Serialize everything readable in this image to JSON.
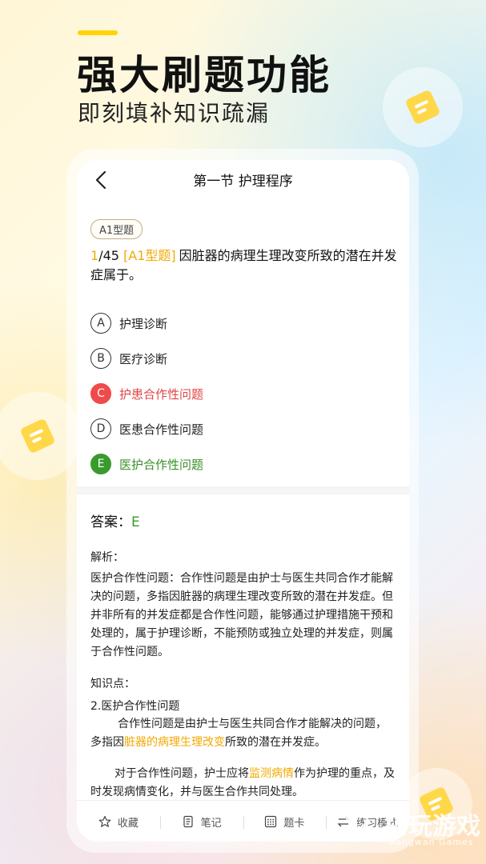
{
  "promo": {
    "headline": "强大刷题功能",
    "subheadline": "即刻填补知识疏漏"
  },
  "nav": {
    "title": "第一节 护理程序"
  },
  "question": {
    "type_tag": "A1型题",
    "number_current": "1",
    "number_total": "/45",
    "type_inline": "[A1型题]",
    "text": "因脏器的病理生理改变所致的潜在并发症属于。"
  },
  "options": [
    {
      "letter": "A",
      "text": "护理诊断",
      "state": "normal"
    },
    {
      "letter": "B",
      "text": "医疗诊断",
      "state": "normal"
    },
    {
      "letter": "C",
      "text": "护患合作性问题",
      "state": "wrong"
    },
    {
      "letter": "D",
      "text": "医患合作性问题",
      "state": "normal"
    },
    {
      "letter": "E",
      "text": "医护合作性问题",
      "state": "right"
    }
  ],
  "answer": {
    "label": "答案：",
    "value": "E"
  },
  "analysis": {
    "label": "解析：",
    "text": "医护合作性问题：合作性问题是由护士与医生共同合作才能解决的问题，多指因脏器的病理生理改变所致的潜在并发症。但并非所有的并发症都是合作性问题，能够通过护理措施干预和处理的，属于护理诊断，不能预防或独立处理的并发症，则属于合作性问题。"
  },
  "knowledge": {
    "label": "知识点：",
    "title": "2.医护合作性问题",
    "p1_a": "合作性问题是由护士与医生共同合作才能解决的问题，多指因",
    "p1_hl": "脏器的病理生理改变",
    "p1_b": "所致的潜在并发症。",
    "p2_a": "对于合作性问题，护士应将",
    "p2_hl": "监测病情",
    "p2_b": "作为护理的重点，及时发现病情变化，并与医生合作共同处理。"
  },
  "tabbar": {
    "items": [
      {
        "label": "收藏",
        "icon": "star-icon"
      },
      {
        "label": "笔记",
        "icon": "note-icon"
      },
      {
        "label": "题卡",
        "icon": "grid-icon"
      },
      {
        "label": "练习模式",
        "icon": "switch-icon"
      }
    ]
  },
  "watermark": {
    "main": "扔玩游戏",
    "sub": "Rengwan Games"
  },
  "colors": {
    "accent": "#ffd400",
    "highlight": "#f2a900",
    "correct": "#3a9b2c",
    "wrong": "#f04a4a"
  }
}
